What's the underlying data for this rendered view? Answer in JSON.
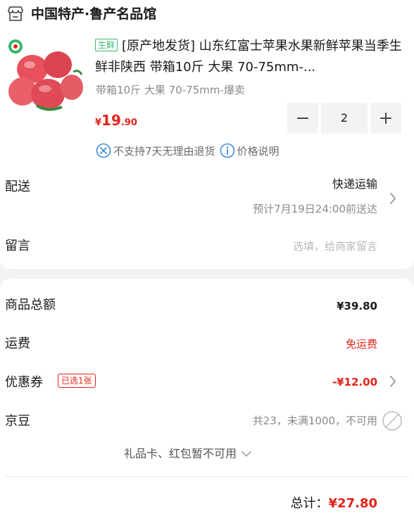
{
  "shop": {
    "name": "中国特产·鲁产名品馆",
    "icon": "shop-icon"
  },
  "product": {
    "tag": "生鲜",
    "title": "[原产地发货] 山东红富士苹果水果新鲜苹果当季生鲜非陕西 带箱10斤 大果 70-75mm-...",
    "spec": "带箱10斤 大果 70-75mm-爆卖",
    "price": {
      "currency": "¥",
      "integer": "19",
      "decimal": ".90"
    },
    "quantity": "2"
  },
  "services": [
    {
      "icon": "no-return-icon",
      "label": "不支持7天无理由退货"
    },
    {
      "icon": "info-icon",
      "label": "价格说明"
    }
  ],
  "delivery": {
    "label": "配送",
    "type": "快递运输",
    "time": "预计7月19日24:00前送达"
  },
  "note": {
    "label": "留言",
    "placeholder": "选填，给商家留言"
  },
  "summary": {
    "goods_total_label": "商品总额",
    "goods_total": "¥39.80",
    "shipping_label": "运费",
    "shipping": "免运费",
    "coupon_label": "优惠券",
    "coupon_badge": "已选1张",
    "coupon_value": "-¥12.00",
    "beans_label": "京豆",
    "beans_value": "共23，未满1000，不可用",
    "gift_card": "礼品卡、红包暂不可用",
    "total_label": "总计：",
    "total": "¥27.80"
  },
  "colors": {
    "accent_red": "#e2231a",
    "fresh_green": "#3bb56c",
    "info_blue": "#3a8bd8"
  }
}
